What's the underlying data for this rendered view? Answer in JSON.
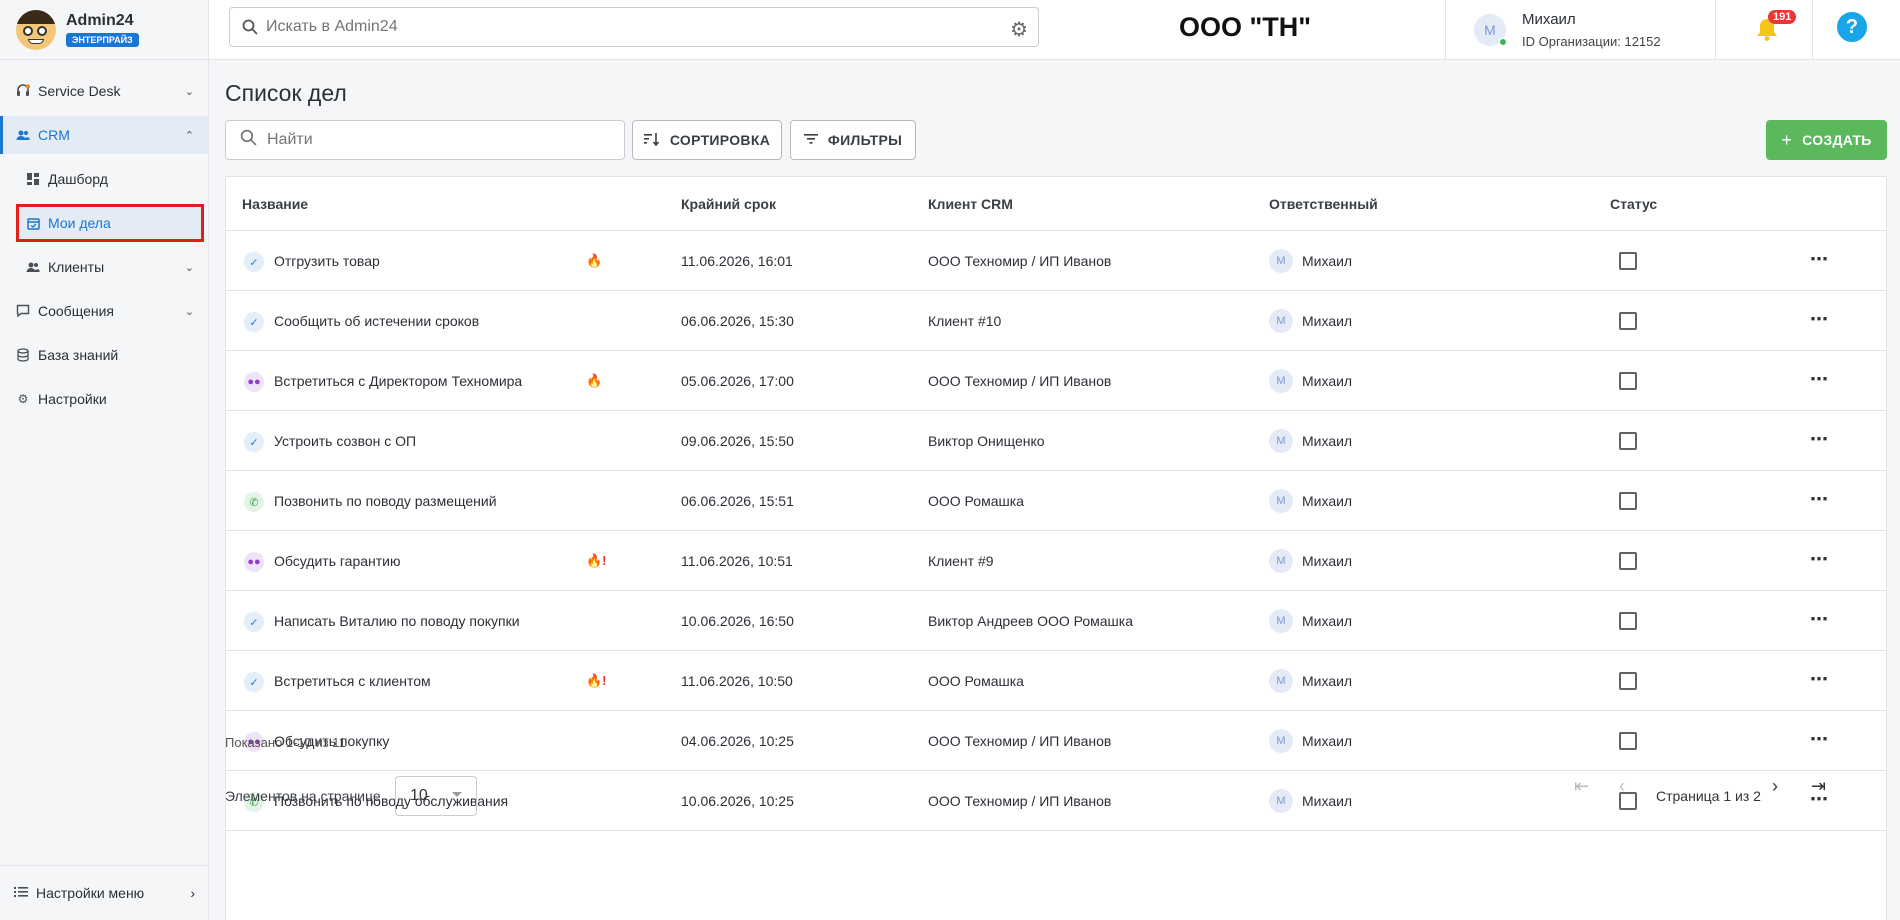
{
  "brand": {
    "name": "Admin24",
    "badge": "ЭНТЕРПРАЙЗ"
  },
  "sidebar": {
    "items": [
      {
        "label": "Service Desk"
      },
      {
        "label": "CRM"
      },
      {
        "label": "Дашборд"
      },
      {
        "label": "Мои дела"
      },
      {
        "label": "Клиенты"
      },
      {
        "label": "Сообщения"
      },
      {
        "label": "База знаний"
      },
      {
        "label": "Настройки"
      }
    ],
    "footer_label": "Настройки меню"
  },
  "topbar": {
    "search_placeholder": "Искать в Admin24",
    "org_title": "ООО \"ТН\"",
    "user_initial": "М",
    "user_name": "Михаил",
    "org_id": "ID Организации: 12152",
    "notifications": "191",
    "help": "?"
  },
  "page": {
    "title": "Список дел",
    "search_placeholder": "Найти",
    "sort_label": "СОРТИРОВКА",
    "filter_label": "ФИЛЬТРЫ",
    "create_label": "СОЗДАТЬ"
  },
  "table": {
    "columns": [
      "Название",
      "Крайний срок",
      "Клиент CRM",
      "Ответственный",
      "Статус"
    ],
    "rows": [
      {
        "type": "task",
        "name": "Отгрузить товар",
        "priority": "normal",
        "deadline": "11.06.2026, 16:01",
        "client": "ООО Техномир / ИП Иванов",
        "resp_initial": "М",
        "responsible": "Михаил"
      },
      {
        "type": "task",
        "name": "Сообщить об истечении сроков",
        "priority": "",
        "deadline": "06.06.2026, 15:30",
        "client": "Клиент #10",
        "resp_initial": "М",
        "responsible": "Михаил"
      },
      {
        "type": "meeting",
        "name": "Встретиться с Директором Техномира",
        "priority": "normal",
        "deadline": "05.06.2026, 17:00",
        "client": "ООО Техномир / ИП Иванов",
        "resp_initial": "М",
        "responsible": "Михаил"
      },
      {
        "type": "task",
        "name": "Устроить созвон с ОП",
        "priority": "",
        "deadline": "09.06.2026, 15:50",
        "client": "Виктор Онищенко",
        "resp_initial": "М",
        "responsible": "Михаил"
      },
      {
        "type": "call",
        "name": "Позвонить по поводу размещений",
        "priority": "",
        "deadline": "06.06.2026, 15:51",
        "client": "ООО Ромашка",
        "resp_initial": "М",
        "responsible": "Михаил"
      },
      {
        "type": "meeting",
        "name": "Обсудить гарантию",
        "priority": "urgent",
        "deadline": "11.06.2026, 10:51",
        "client": "Клиент #9",
        "resp_initial": "М",
        "responsible": "Михаил"
      },
      {
        "type": "task",
        "name": "Написать Виталию по поводу покупки",
        "priority": "",
        "deadline": "10.06.2026, 16:50",
        "client": "Виктор Андреев ООО Ромашка",
        "resp_initial": "М",
        "responsible": "Михаил"
      },
      {
        "type": "task",
        "name": "Встретиться с клиентом",
        "priority": "urgent",
        "deadline": "11.06.2026, 10:50",
        "client": "ООО Ромашка",
        "resp_initial": "М",
        "responsible": "Михаил"
      },
      {
        "type": "meeting",
        "name": "Обсудить покупку",
        "priority": "",
        "deadline": "04.06.2026, 10:25",
        "client": "ООО Техномир / ИП Иванов",
        "resp_initial": "М",
        "responsible": "Михаил"
      },
      {
        "type": "call",
        "name": "Позвонить по поводу обслуживания",
        "priority": "",
        "deadline": "10.06.2026, 10:25",
        "client": "ООО Техномир / ИП Иванов",
        "resp_initial": "М",
        "responsible": "Михаил"
      }
    ],
    "shown": "Показано 1-10 из 11",
    "per_page_label": "Элементов на странице",
    "per_page_value": "10",
    "page_label": "Страница 1 из 2"
  },
  "colors": {
    "accent": "#1976d2",
    "create": "#5cb85c",
    "badge": "#e53935",
    "highlight": "#e31c1c"
  }
}
